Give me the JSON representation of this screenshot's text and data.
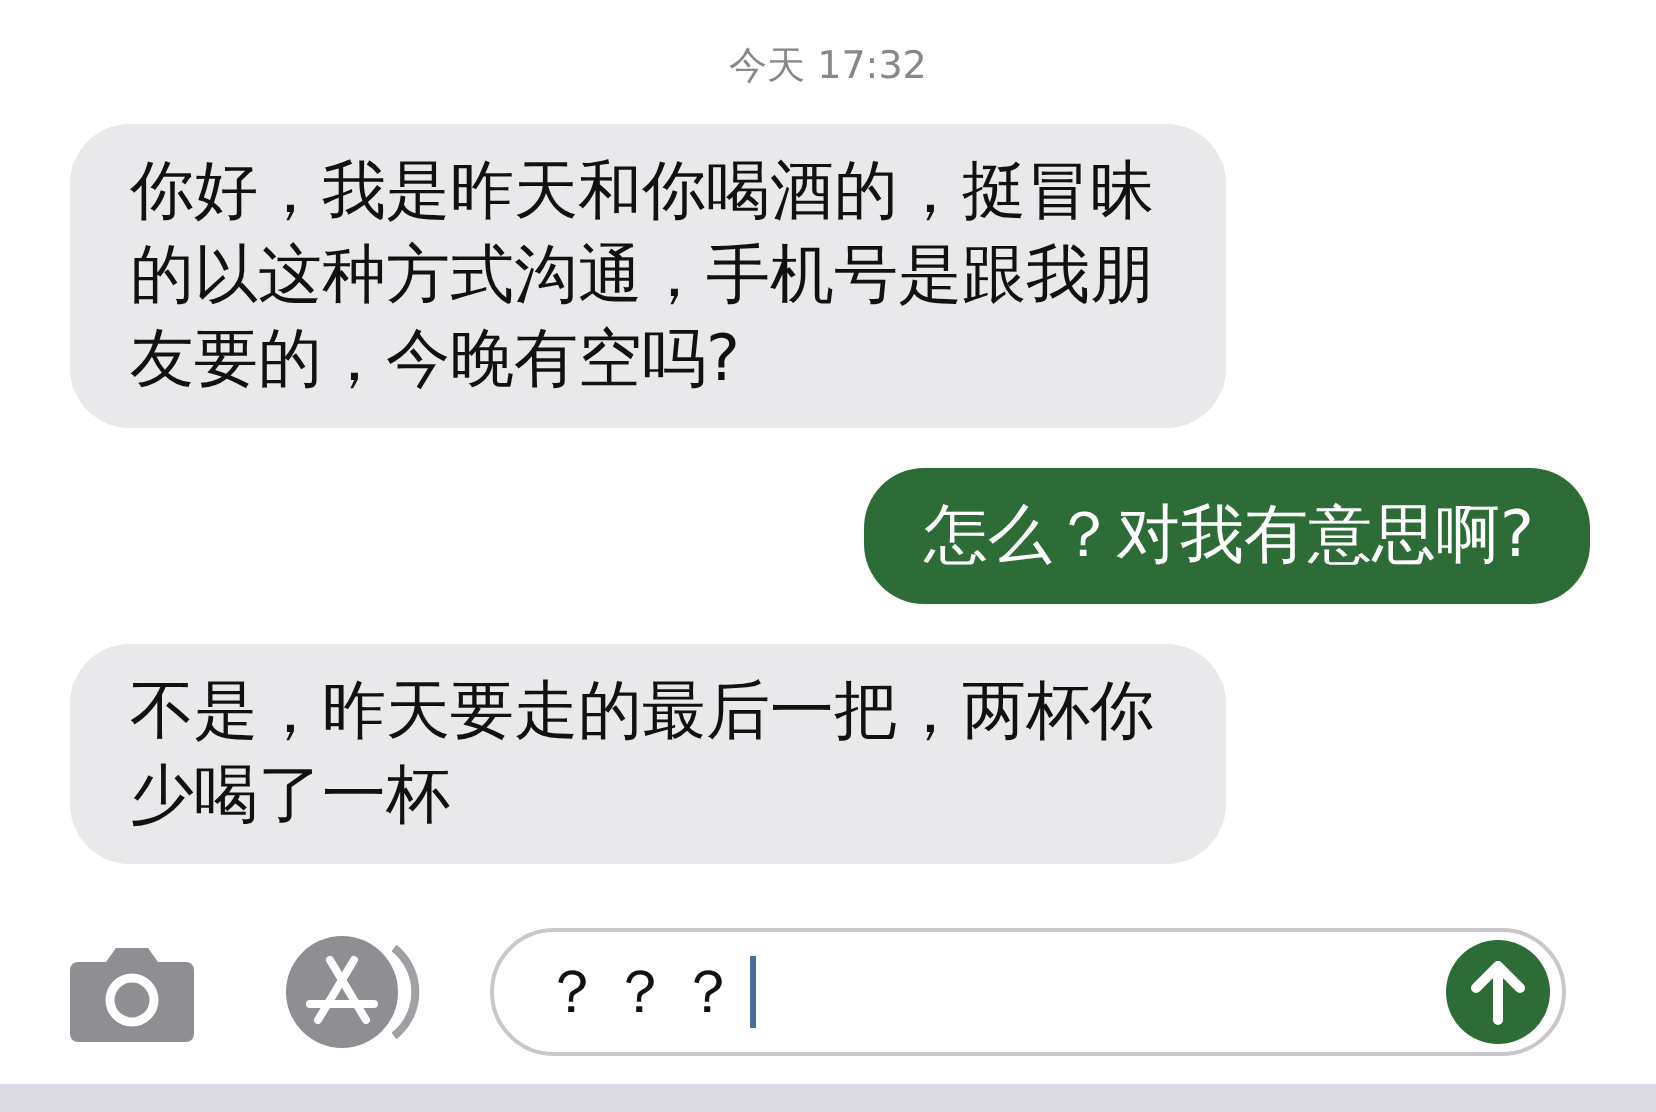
{
  "timestamp": "今天 17:32",
  "messages": [
    {
      "kind": "incoming",
      "text": "你好，我是昨天和你喝酒的，挺冒昧的以这种方式沟通，手机号是跟我朋友要的，今晚有空吗?"
    },
    {
      "kind": "outgoing",
      "text": "怎么？对我有意思啊?"
    },
    {
      "kind": "incoming",
      "text": "不是，昨天要走的最后一把，两杯你少喝了一杯"
    }
  ],
  "compose": {
    "value": "？？？"
  }
}
